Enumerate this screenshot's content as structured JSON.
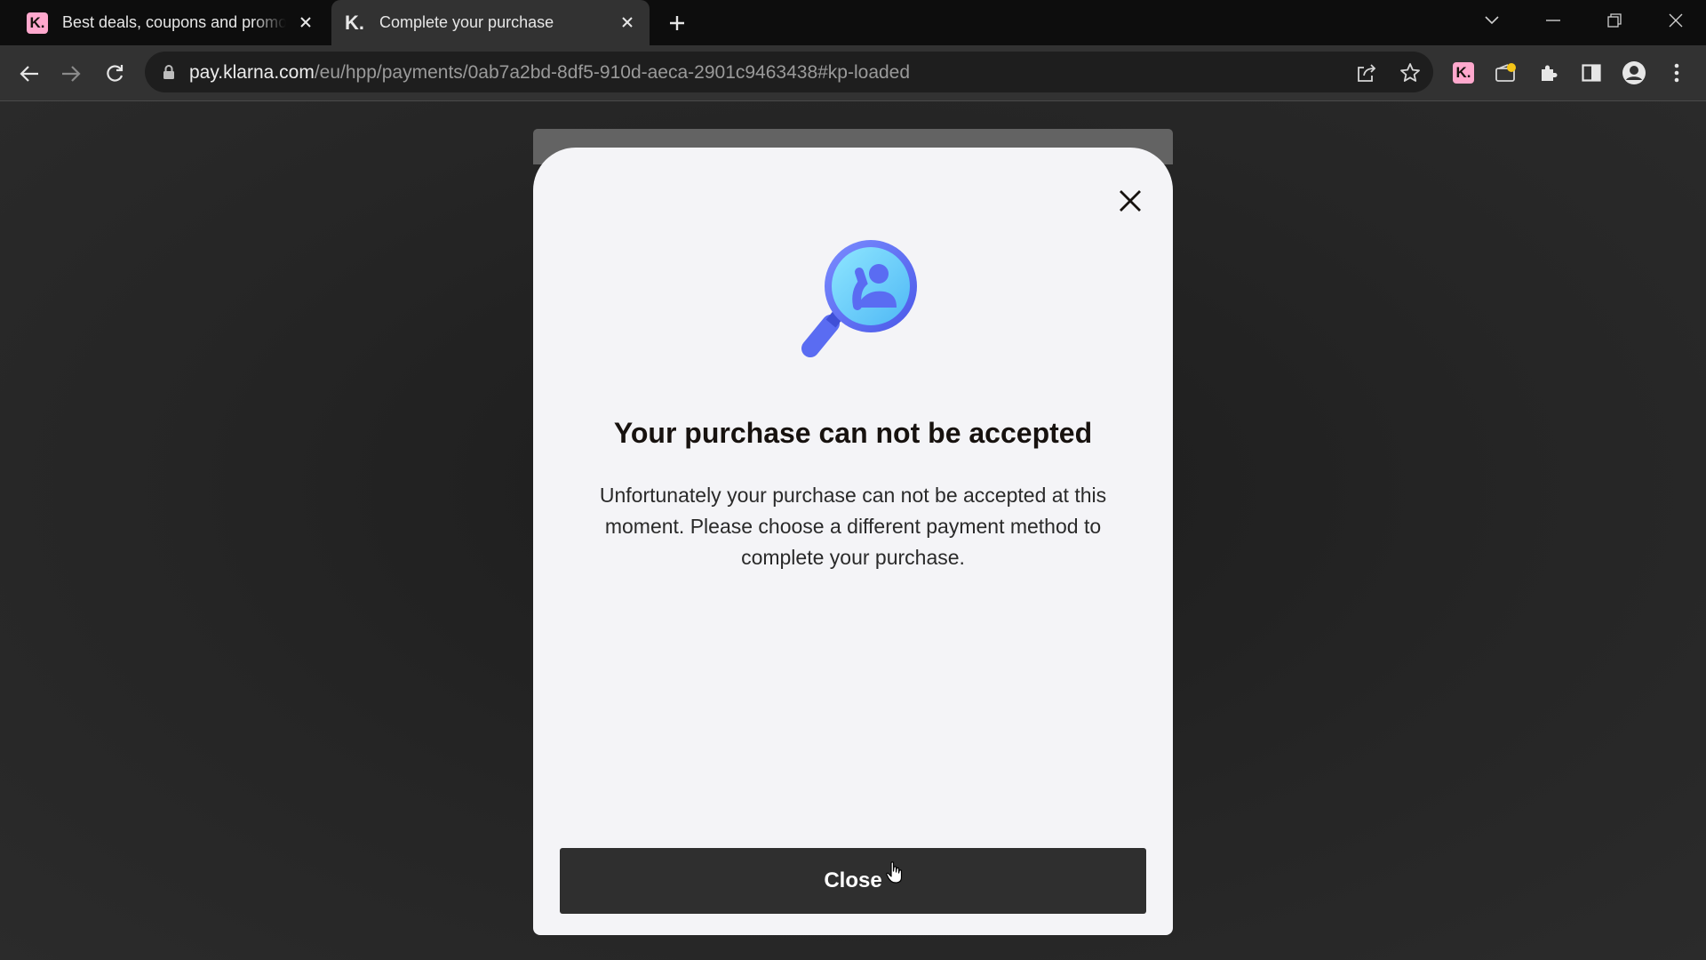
{
  "browser": {
    "tabs": [
      {
        "title": "Best deals, coupons and promo",
        "favicon": "K.",
        "active": false
      },
      {
        "title": "Complete your purchase",
        "favicon": "K.",
        "active": true
      }
    ],
    "url_host": "pay.klarna.com",
    "url_path": "/eu/hpp/payments/0ab7a2bd-8df5-910d-aeca-2901c9463438#kp-loaded",
    "extension_label": "K."
  },
  "modal": {
    "title": "Your purchase can not be accepted",
    "message": "Unfortunately your purchase can not be accepted at this moment. Please choose a different payment method to complete your purchase.",
    "close_button": "Close",
    "illustration": "magnifier-person-icon"
  },
  "colors": {
    "accent_blue": "#5a6cf2",
    "light_blue": "#5fd0fb",
    "klarna_pink": "#ffa8cd",
    "button_dark": "#2f2f2f"
  }
}
